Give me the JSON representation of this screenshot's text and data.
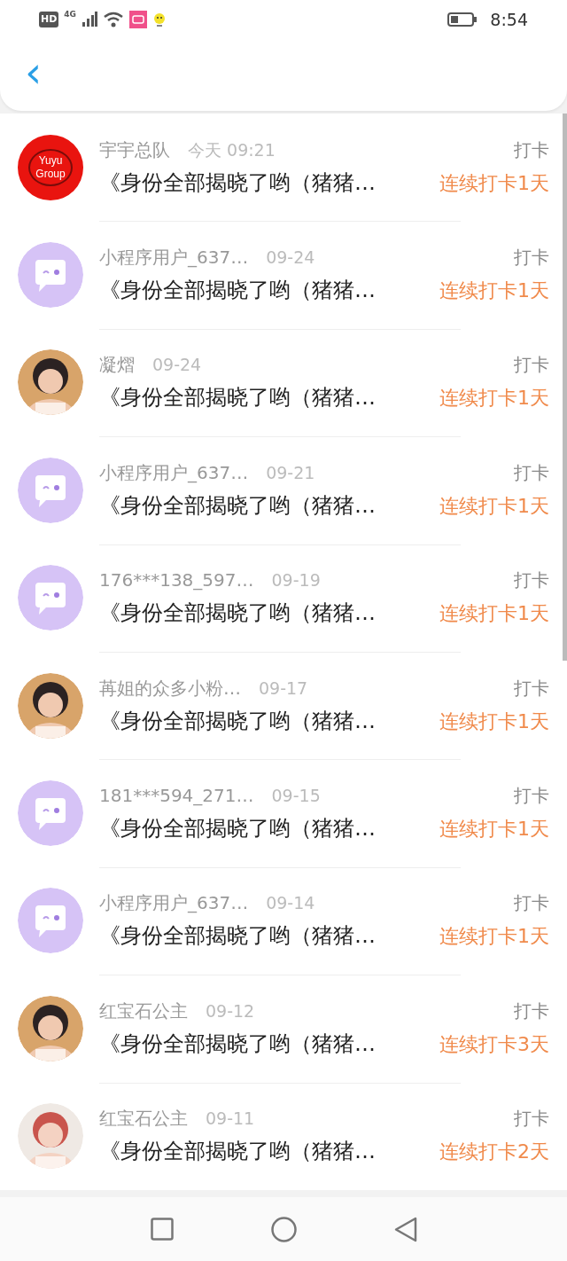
{
  "status_bar": {
    "network": "4G",
    "hd": "HD",
    "time": "8:54"
  },
  "header": {
    "back": "‹"
  },
  "checkins": [
    {
      "avatar": {
        "kind": "logo",
        "text": "Yuyu Group"
      },
      "name": "宇宇总队",
      "date": "今天 09:21",
      "title": "《身份全部揭晓了哟（猪猪…",
      "type": "打卡",
      "streak": "连续打卡1天"
    },
    {
      "avatar": {
        "kind": "chat"
      },
      "name": "小程序用户_637…",
      "date": "09-24",
      "title": "《身份全部揭晓了哟（猪猪…",
      "type": "打卡",
      "streak": "连续打卡1天"
    },
    {
      "name": "凝熠",
      "date": "09-24",
      "title": "《身份全部揭晓了哟（猪猪…",
      "type": "打卡",
      "streak": "连续打卡1天"
    },
    {
      "avatar": {
        "kind": "chat"
      },
      "name": "小程序用户_637…",
      "date": "09-21",
      "title": "《身份全部揭晓了哟（猪猪…",
      "type": "打卡",
      "streak": "连续打卡1天"
    },
    {
      "avatar": {
        "kind": "chat"
      },
      "name": "176***138_597…",
      "date": "09-19",
      "title": "《身份全部揭晓了哟（猪猪…",
      "type": "打卡",
      "streak": "连续打卡1天"
    },
    {
      "name": "苒姐的众多小粉…",
      "date": "09-17",
      "title": "《身份全部揭晓了哟（猪猪…",
      "type": "打卡",
      "streak": "连续打卡1天"
    },
    {
      "avatar": {
        "kind": "chat"
      },
      "name": "181***594_271…",
      "date": "09-15",
      "title": "《身份全部揭晓了哟（猪猪…",
      "type": "打卡",
      "streak": "连续打卡1天"
    },
    {
      "avatar": {
        "kind": "chat"
      },
      "name": "小程序用户_637…",
      "date": "09-14",
      "title": "《身份全部揭晓了哟（猪猪…",
      "type": "打卡",
      "streak": "连续打卡1天"
    },
    {
      "name": "红宝石公主",
      "date": "09-12",
      "title": "《身份全部揭晓了哟（猪猪…",
      "type": "打卡",
      "streak": "连续打卡3天"
    },
    {
      "name": "红宝石公主",
      "date": "09-11",
      "title": "《身份全部揭晓了哟（猪猪…",
      "type": "打卡",
      "streak": "连续打卡2天"
    }
  ]
}
